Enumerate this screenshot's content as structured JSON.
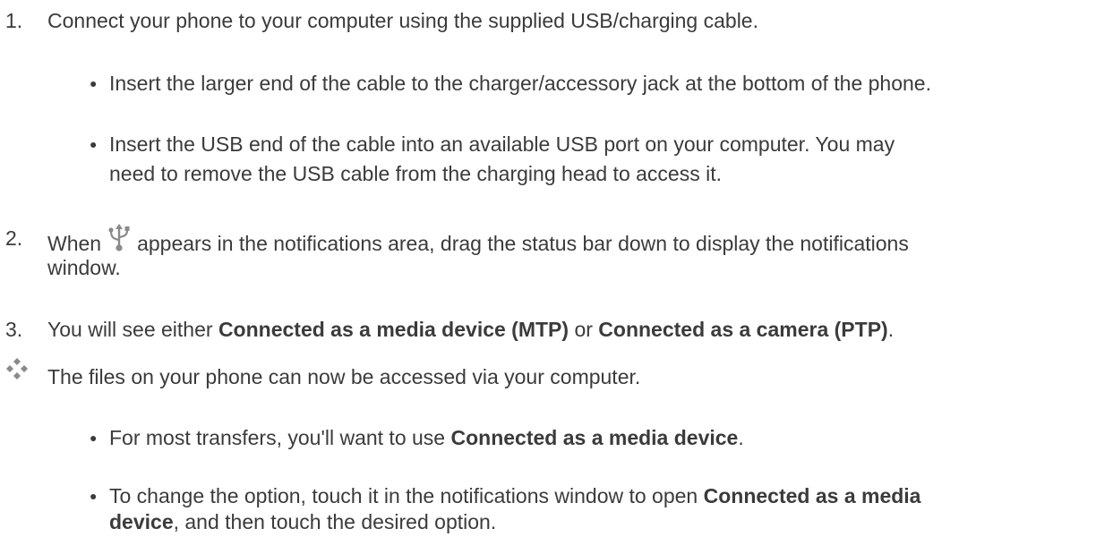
{
  "steps": [
    {
      "number": "1.",
      "text": "Connect your phone to your computer using the supplied USB/charging cable.",
      "bullets": [
        {
          "lines": [
            "Insert the larger end of the cable to the charger/accessory jack at the bottom of the phone."
          ]
        },
        {
          "lines": [
            "Insert the USB end of the cable into an available USB port on your computer. You may",
            "need to remove the USB cable from the charging head to access it."
          ]
        }
      ]
    },
    {
      "number": "2.",
      "text_before_icon": "When",
      "icon": "usb-icon",
      "text_after_icon": "appears in the notifications area, drag the status bar down to display the notifications",
      "continuation": "window."
    },
    {
      "number": "3.",
      "text_prefix": "You will see either ",
      "bold_1": "Connected as a media device (MTP)",
      "text_mid": " or ",
      "bold_2": "Connected as a camera (PTP)",
      "text_suffix": "."
    }
  ],
  "result": {
    "icon": "diamond-bullet-icon",
    "text": "The files on your phone can now be accessed via your computer.",
    "bullets": [
      {
        "prefix": "For most transfers, you'll want to use ",
        "bold": "Connected as a media device",
        "suffix": "."
      },
      {
        "line1_prefix": "To change the option, touch it in the notifications window to open ",
        "line1_bold": "Connected as a media",
        "line2_bold": "device",
        "line2_suffix": ", and then touch the desired option."
      }
    ]
  },
  "colors": {
    "text": "#3b3b3b",
    "icon": "#8a8a8a"
  }
}
